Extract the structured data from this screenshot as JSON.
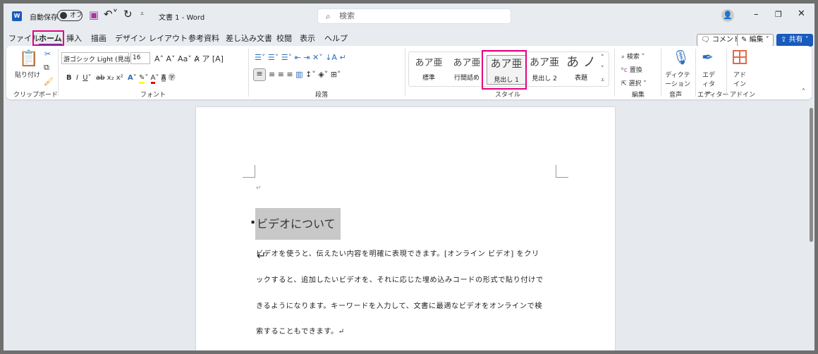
{
  "titlebar": {
    "autosave_label": "自動保存",
    "autosave_state": "オフ",
    "title": "文書 1 - Word",
    "search_placeholder": "検索"
  },
  "tabs": [
    "ファイル",
    "ホーム",
    "挿入",
    "描画",
    "デザイン",
    "レイアウト",
    "参考資料",
    "差し込み文書",
    "校閲",
    "表示",
    "ヘルプ"
  ],
  "active_tab": "ホーム",
  "actions": {
    "comment": "コメント",
    "edit": "編集",
    "share": "共有"
  },
  "ribbon": {
    "clipboard": {
      "paste": "貼り付け",
      "label": "クリップボード"
    },
    "font": {
      "name": "游ゴシック Light (見出",
      "size": "16",
      "label": "フォント"
    },
    "paragraph": {
      "label": "段落"
    },
    "styles": {
      "items": [
        {
          "sample": "あア亜",
          "name": "標準"
        },
        {
          "sample": "あア亜",
          "name": "行間詰め"
        },
        {
          "sample": "あア亜",
          "name": "見出し 1"
        },
        {
          "sample": "あア亜",
          "name": "見出し 2"
        },
        {
          "sample": "あ ノ",
          "name": "表題"
        }
      ],
      "selected": "見出し 1",
      "label": "スタイル"
    },
    "editing": {
      "find": "検索",
      "replace": "置換",
      "select": "選択",
      "label": "編集"
    },
    "voice": {
      "dictate": "ディクテーション",
      "label": "音声"
    },
    "editor": {
      "name": "エディター",
      "label": "エディター"
    },
    "addins": {
      "name": "アドイン",
      "label": "アドイン"
    }
  },
  "highlight_color": "#e6007e",
  "document": {
    "heading": "ビデオについて↵",
    "lines": [
      "ビデオを使うと、伝えたい内容を明確に表現できます。[オンライン ビデオ] をクリ",
      "ックすると、追加したいビデオを、それに応じた埋め込みコードの形式で貼り付けで",
      "きるようになります。キーワードを入力して、文書に最適なビデオをオンラインで検",
      "索することもできます。↵"
    ],
    "empty_mark": "↵"
  }
}
